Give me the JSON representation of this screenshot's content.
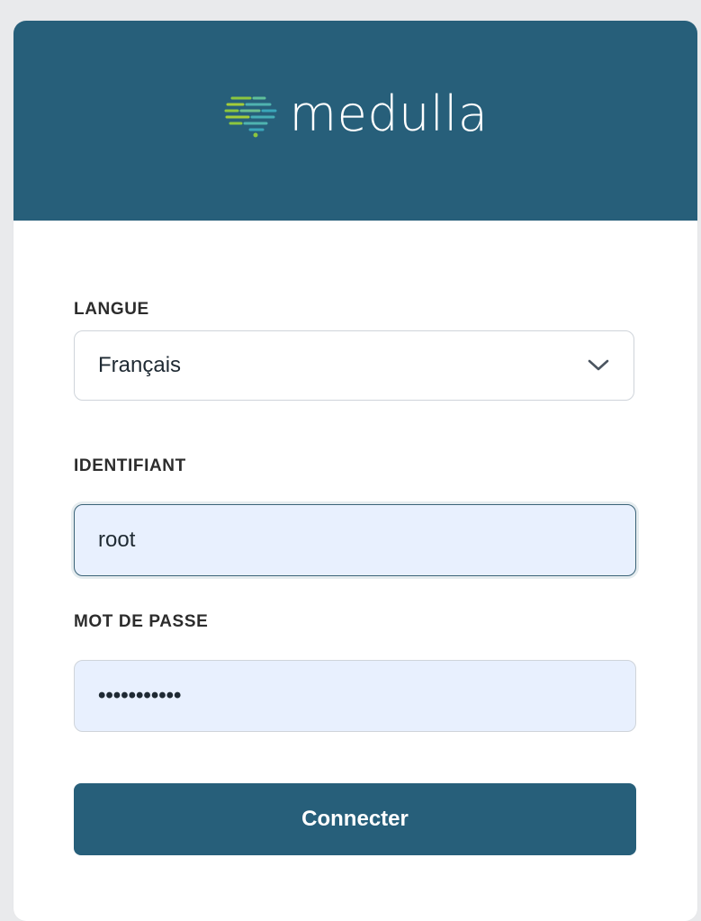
{
  "brand": {
    "name": "medulla",
    "header_color": "#275f7a",
    "logo_icon": "brain-circuit-icon"
  },
  "form": {
    "language": {
      "label": "LANGUE",
      "selected": "Français"
    },
    "username": {
      "label": "IDENTIFIANT",
      "value": "root"
    },
    "password": {
      "label": "MOT DE PASSE",
      "masked_value": "•••••••••••"
    },
    "submit_label": "Connecter"
  },
  "colors": {
    "primary": "#275f7a",
    "input_fill": "#e8f0fe",
    "page_bg": "#e9eaec"
  }
}
